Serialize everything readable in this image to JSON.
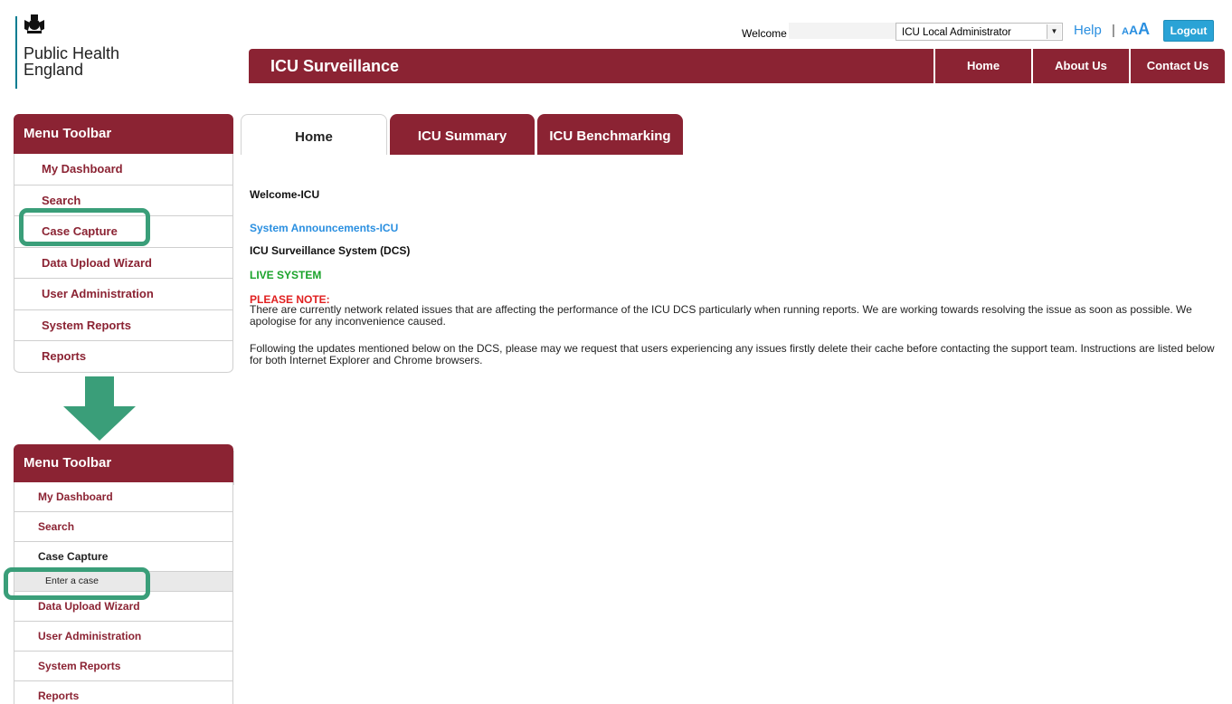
{
  "header": {
    "logo_line1": "Public Health",
    "logo_line2": "England",
    "welcome_label": "Welcome",
    "role_select_value": "ICU Local Administrator",
    "help_label": "Help",
    "separator": "|",
    "text_size_small": "A",
    "text_size_medium": "A",
    "text_size_large": "A",
    "logout_label": "Logout"
  },
  "topbar": {
    "title": "ICU Surveillance",
    "nav": [
      "Home",
      "About Us",
      "Contact Us"
    ]
  },
  "sidebar_top": {
    "title": "Menu Toolbar",
    "items": [
      "My Dashboard",
      "Search",
      "Case Capture",
      "Data Upload Wizard",
      "User Administration",
      "System Reports",
      "Reports"
    ]
  },
  "sidebar_bottom": {
    "title": "Menu Toolbar",
    "items": [
      "My Dashboard",
      "Search",
      "Case Capture",
      "Data Upload Wizard",
      "User Administration",
      "System Reports",
      "Reports"
    ],
    "subitem": "Enter a case"
  },
  "tabs": [
    "Home",
    "ICU Summary",
    "ICU Benchmarking"
  ],
  "content": {
    "welcome": "Welcome-ICU",
    "announcements": "System Announcements-ICU",
    "system_name": "ICU Surveillance System (DCS)",
    "live": "LIVE SYSTEM",
    "note_title": "PLEASE NOTE:",
    "note_text": "There are currently network related issues that are affecting the performance of the ICU DCS particularly when running reports. We are working towards resolving the issue as soon as possible. We apologise for any inconvenience caused.",
    "followup_text": "Following the updates mentioned below on the DCS, please may we request that users experiencing any issues firstly delete their cache before contacting the support team. Instructions are listed below for both Internet Explorer and Chrome browsers."
  },
  "colors": {
    "brand_maroon": "#8b2333",
    "highlight_green": "#3a9e79",
    "link_blue": "#2a8fe0",
    "live_green": "#1aa32a",
    "note_red": "#e02020"
  }
}
